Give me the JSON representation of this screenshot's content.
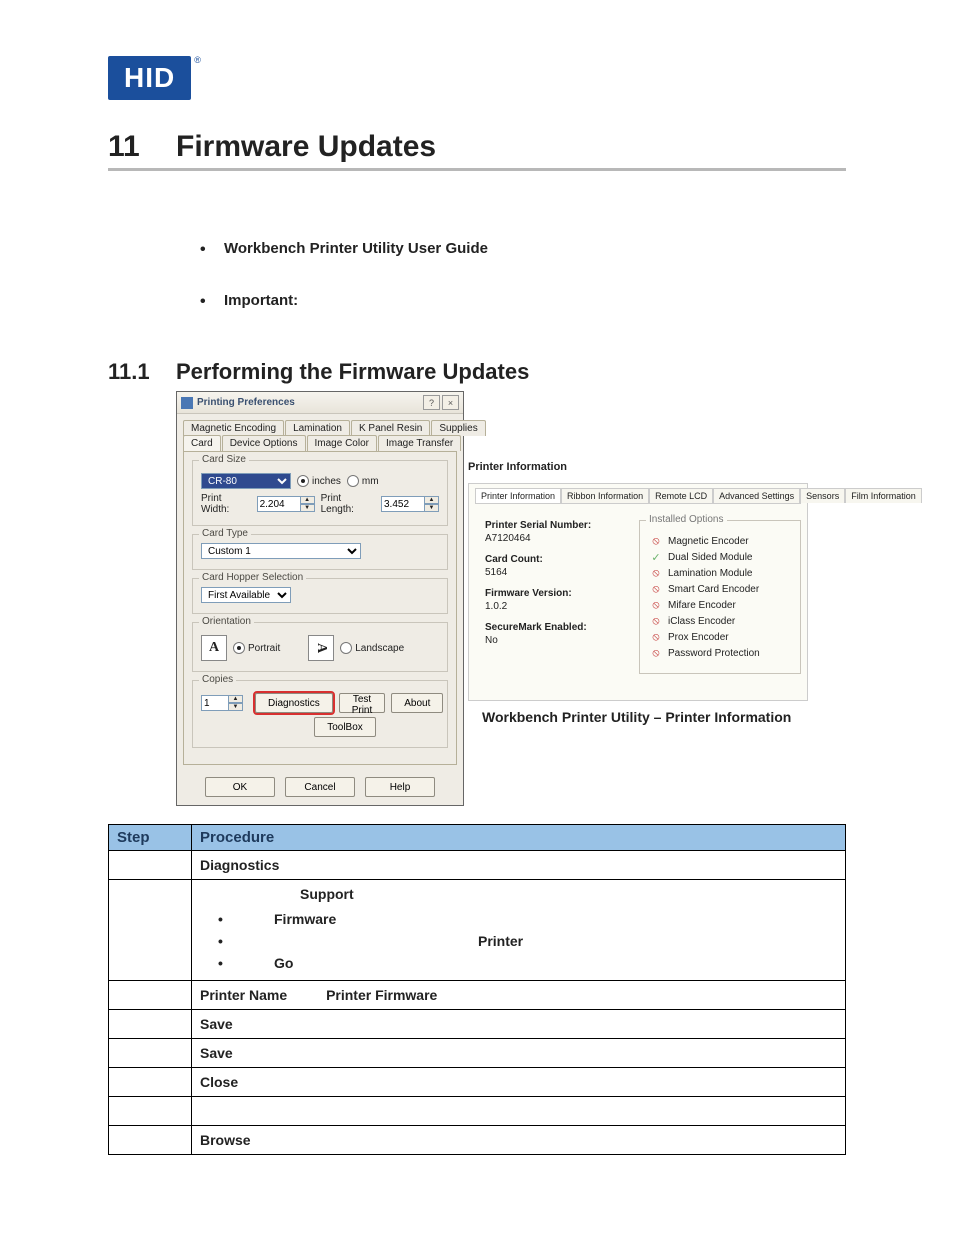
{
  "logo": {
    "text": "HID",
    "reg": "®"
  },
  "h1": {
    "num": "11",
    "text": "Firmware Updates"
  },
  "intro_bullets": [
    "Workbench Printer Utility User Guide",
    "Important:"
  ],
  "h2": {
    "num": "11.1",
    "text": "Performing the Firmware Updates"
  },
  "dialog": {
    "title": "Printing Preferences",
    "help_btn": "?",
    "close_btn": "×",
    "tabs_row1": [
      "Magnetic Encoding",
      "Lamination",
      "K Panel Resin",
      "Supplies"
    ],
    "tabs_row2": [
      "Card",
      "Device Options",
      "Image Color",
      "Image Transfer"
    ],
    "card_size": {
      "title": "Card Size",
      "select": "CR-80",
      "unit_inches": "inches",
      "unit_mm": "mm",
      "print_width_label": "Print Width:",
      "print_width": "2.204",
      "print_length_label": "Print Length:",
      "print_length": "3.452"
    },
    "card_type": {
      "title": "Card Type",
      "select": "Custom 1"
    },
    "hopper": {
      "title": "Card Hopper Selection",
      "select": "First Available"
    },
    "orientation": {
      "title": "Orientation",
      "portrait": "Portrait",
      "landscape": "Landscape",
      "A": "A"
    },
    "copies": {
      "title": "Copies",
      "value": "1",
      "diagnostics": "Diagnostics",
      "test_print": "Test Print",
      "about": "About",
      "toolbox": "ToolBox"
    },
    "footer": {
      "ok": "OK",
      "cancel": "Cancel",
      "help": "Help"
    }
  },
  "panel": {
    "title": "Printer Information",
    "tabs": [
      "Printer Information",
      "Ribbon Information",
      "Remote LCD",
      "Advanced Settings",
      "Sensors",
      "Film Information"
    ],
    "info": {
      "serial_label": "Printer Serial Number:",
      "serial": "A7120464",
      "count_label": "Card Count:",
      "count": "5164",
      "fw_label": "Firmware Version:",
      "fw": "1.0.2",
      "secure_label": "SecureMark Enabled:",
      "secure": "No"
    },
    "installed_options_title": "Installed Options",
    "options": [
      {
        "icon": "red",
        "label": "Magnetic Encoder"
      },
      {
        "icon": "grn",
        "label": "Dual Sided Module"
      },
      {
        "icon": "red",
        "label": "Lamination Module"
      },
      {
        "icon": "red",
        "label": "Smart Card Encoder"
      },
      {
        "icon": "red",
        "label": "Mifare Encoder"
      },
      {
        "icon": "red",
        "label": "iClass Encoder"
      },
      {
        "icon": "red",
        "label": "Prox Encoder"
      },
      {
        "icon": "red",
        "label": "Password Protection"
      }
    ],
    "caption": "Workbench Printer Utility – Printer Information"
  },
  "proc_table": {
    "headers": {
      "step": "Step",
      "procedure": "Procedure"
    },
    "rows": [
      {
        "cells": [
          "",
          "Diagnostics"
        ]
      },
      {
        "cells_complex": {
          "note": "Support",
          "bullets": [
            "Firmware",
            "Printer",
            "Go"
          ]
        }
      },
      {
        "cells": [
          "",
          "Printer Name          Printer Firmware"
        ]
      },
      {
        "cells": [
          "",
          "Save"
        ]
      },
      {
        "cells": [
          "",
          "Save"
        ]
      },
      {
        "cells": [
          "",
          "Close"
        ]
      },
      {
        "cells": [
          "",
          ""
        ]
      },
      {
        "cells": [
          "",
          "Browse"
        ]
      }
    ]
  }
}
